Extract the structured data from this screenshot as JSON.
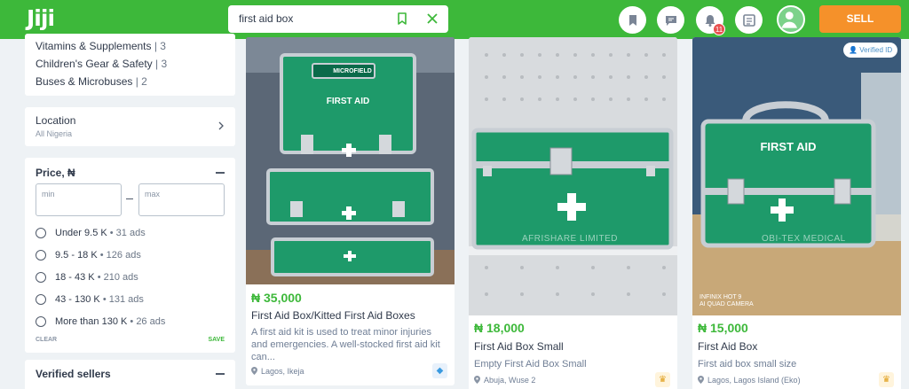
{
  "header": {
    "logo": "Jiji",
    "search_value": "first aid box",
    "notification_count": "11",
    "sell_label": "SELL",
    "colors": {
      "brand": "#3db83a",
      "sell": "#f5912a"
    }
  },
  "sidebar": {
    "categories": [
      {
        "name": "Vitamins & Supplements",
        "count": "| 3"
      },
      {
        "name": "Children's Gear & Safety",
        "count": "| 3"
      },
      {
        "name": "Buses & Microbuses",
        "count": "| 2"
      }
    ],
    "location": {
      "label": "Location",
      "value": "All Nigeria"
    },
    "price": {
      "title": "Price, ₦",
      "min_placeholder": "min",
      "max_placeholder": "max",
      "ranges": [
        {
          "label": "Under 9.5 K",
          "ads": "• 31 ads"
        },
        {
          "label": "9.5 - 18 K",
          "ads": "• 126 ads"
        },
        {
          "label": "18 - 43 K",
          "ads": "• 210 ads"
        },
        {
          "label": "43 - 130 K",
          "ads": "• 131 ads"
        },
        {
          "label": "More than 130 K",
          "ads": "• 26 ads"
        }
      ],
      "clear_label": "CLEAR",
      "save_label": "SAVE"
    },
    "verified_sellers": {
      "title": "Verified sellers"
    }
  },
  "listings": [
    {
      "price": "₦ 35,000",
      "title": "First Aid Box/Kitted First Aid Boxes",
      "description": "A first aid kit is used to treat minor injuries and emergencies. A well-stocked first aid kit can...",
      "location": "Lagos, Ikeja",
      "image_text": [
        "MICROFIELD",
        "FIRST AID"
      ]
    },
    {
      "price": "₦ 18,000",
      "title": "First Aid Box Small",
      "description": "Empty First Aid Box Small",
      "location": "Abuja, Wuse 2",
      "image_text": [
        "AFRISHARE LIMITED"
      ]
    },
    {
      "price": "₦ 15,000",
      "title": "First Aid Box",
      "description": "First aid box small size",
      "location": "Lagos, Lagos Island (Eko)",
      "verified_label": "Verified ID",
      "image_text": [
        "FIRST AID",
        "OBI-TEX MEDICAL",
        "INFINIX HOT 9",
        "AI QUAD CAMERA"
      ]
    }
  ]
}
